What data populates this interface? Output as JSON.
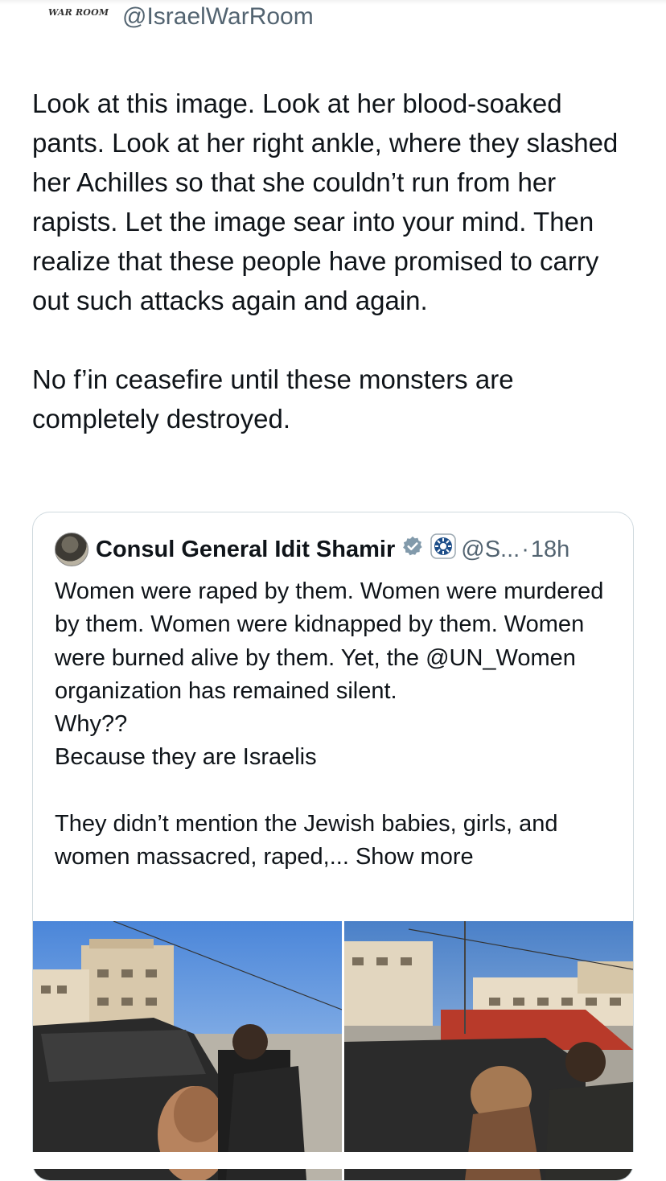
{
  "header": {
    "logo_text": "WAR ROOM",
    "handle": "@IsraelWarRoom"
  },
  "tweet": {
    "paragraph_1": "Look at this image. Look at her blood-soaked pants. Look at her right ankle, where they slashed her Achilles so that she couldn’t run from her rapists. Let the image sear into your mind. Then realize that these people have promised to carry out such attacks again and again.",
    "paragraph_2": "No f’in ceasefire until these monsters are completely destroyed."
  },
  "quoted_tweet": {
    "name": "Consul General Idit Shamir",
    "handle": "@S...",
    "separator": "·",
    "time": "18h",
    "lines": [
      "Women were raped by them. Women were murdered by them. Women were kidnapped by them. Women were burned alive by them. Yet, the @UN_Women organization has remained silent.",
      "Why??",
      "Because they are Israelis",
      "",
      "They didn’t mention the Jewish babies, girls, and women massacred, raped,..."
    ],
    "show_more": "Show more"
  },
  "icons": {
    "verified": "verified-badge-icon",
    "affiliate": "government-emblem-icon"
  },
  "colors": {
    "text": "#0f1419",
    "secondary": "#536471",
    "border": "#cfd9de",
    "badge_gray": "#829aab"
  }
}
